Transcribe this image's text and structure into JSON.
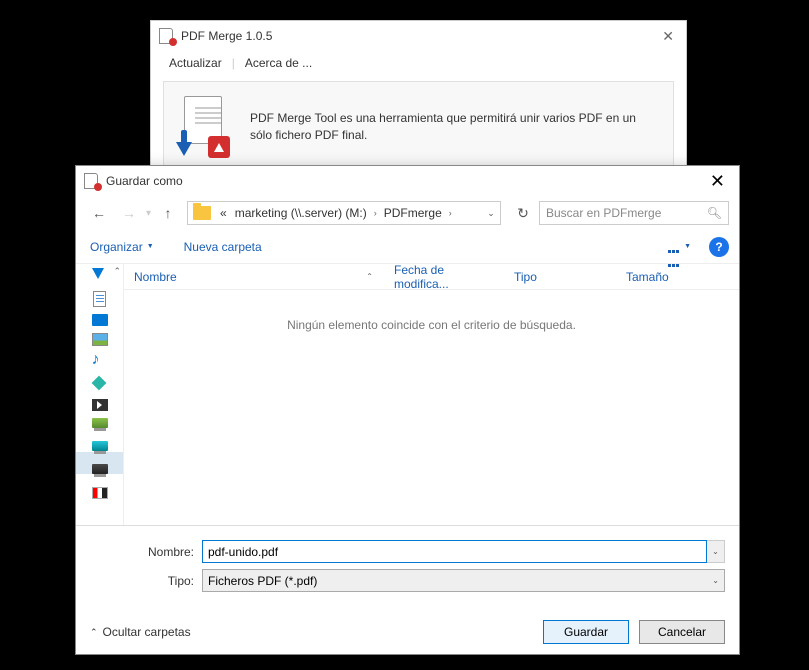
{
  "app": {
    "title": "PDF Merge 1.0.5",
    "menu": {
      "update": "Actualizar",
      "about": "Acerca de ..."
    },
    "banner_text": "PDF Merge Tool es una herramienta que permitirá unir varios PDF en un sólo fichero PDF final."
  },
  "dialog": {
    "title": "Guardar como",
    "path": {
      "prefix": "«",
      "segment1": "marketing (\\\\.server) (M:)",
      "segment2": "PDFmerge"
    },
    "search_placeholder": "Buscar en PDFmerge",
    "toolbar": {
      "organize": "Organizar",
      "new_folder": "Nueva carpeta"
    },
    "columns": {
      "name": "Nombre",
      "date": "Fecha de modifica...",
      "type": "Tipo",
      "size": "Tamaño"
    },
    "empty_message": "Ningún elemento coincide con el criterio de búsqueda.",
    "fields": {
      "name_label": "Nombre:",
      "name_value": "pdf-unido.pdf",
      "type_label": "Tipo:",
      "type_value": "Ficheros PDF (*.pdf)"
    },
    "footer": {
      "hide_folders": "Ocultar carpetas",
      "save": "Guardar",
      "cancel": "Cancelar"
    }
  }
}
